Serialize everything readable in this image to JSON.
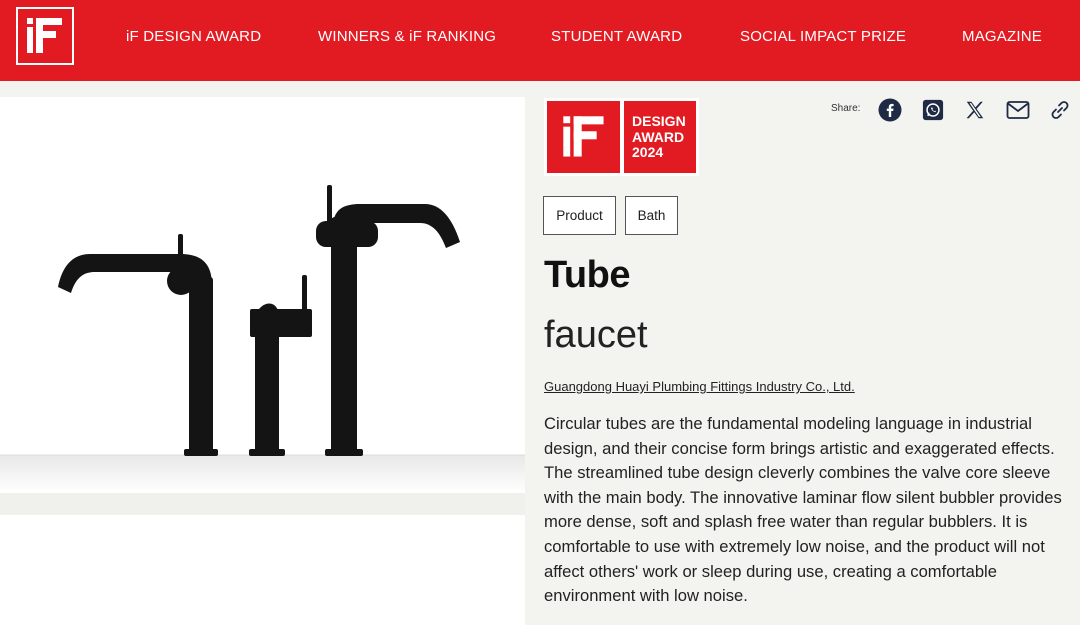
{
  "header": {
    "logo_icon": "if-logo-icon",
    "nav": [
      {
        "label": "iF DESIGN AWARD"
      },
      {
        "label": "WINNERS & iF RANKING"
      },
      {
        "label": "STUDENT AWARD"
      },
      {
        "label": "SOCIAL IMPACT PRIZE"
      },
      {
        "label": "MAGAZINE"
      }
    ]
  },
  "colors": {
    "brand_red": "#e21b23",
    "share_icon": "#1f2a44"
  },
  "badge": {
    "lines": [
      "DESIGN",
      "AWARD",
      "2024"
    ]
  },
  "share": {
    "label": "Share:",
    "icons": [
      "facebook-icon",
      "whatsapp-icon",
      "x-icon",
      "mail-icon",
      "link-icon"
    ]
  },
  "tags": [
    {
      "label": "Product"
    },
    {
      "label": "Bath"
    }
  ],
  "product": {
    "title": "Tube",
    "subtitle": "faucet",
    "company": "Guangdong Huayi Plumbing Fittings Industry Co., Ltd.",
    "description": "Circular tubes are the fundamental modeling language in industrial design, and their concise form brings artistic and exaggerated effects. The streamlined tube design cleverly combines the valve core sleeve with the main body. The innovative laminar flow silent bubbler provides more dense, soft and splash free water than regular bubblers. It is comfortable to use with extremely low noise, and the product will not affect others' work or sleep during use, creating a comfortable environment with low noise."
  }
}
